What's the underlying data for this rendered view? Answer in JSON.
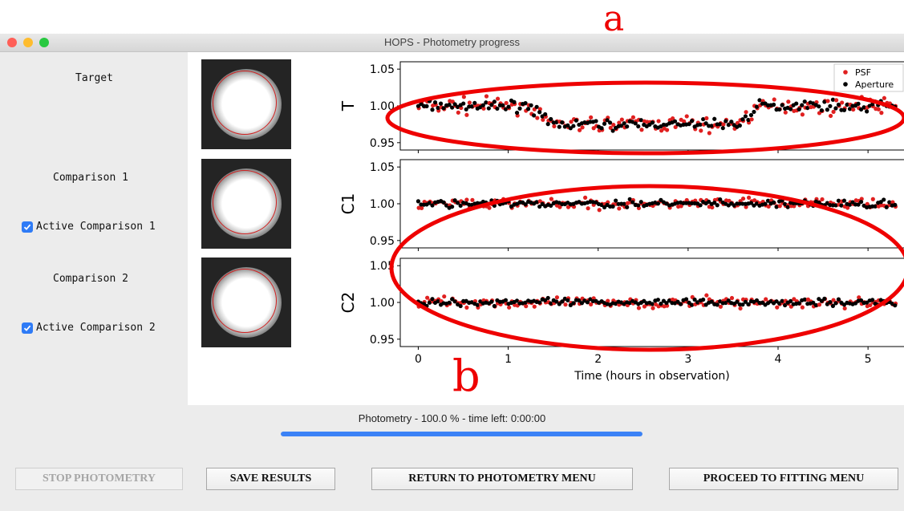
{
  "window": {
    "title": "HOPS - Photometry progress",
    "traffic_lights": [
      "#ff5f57",
      "#febc2e",
      "#28c840"
    ]
  },
  "left_panel": {
    "target_label": "Target",
    "comparison1_label": "Comparison 1",
    "active1_label": "Active Comparison 1",
    "active1_checked": true,
    "comparison2_label": "Comparison 2",
    "active2_label": "Active Comparison 2",
    "active2_checked": true
  },
  "chart_data": {
    "type": "scatter",
    "xlabel": "Time (hours in observation)",
    "xlim": [
      -0.2,
      5.4
    ],
    "xticks": [
      0,
      1,
      2,
      3,
      4,
      5
    ],
    "legend": {
      "placement": "top-right",
      "entries": [
        "PSF",
        "Aperture"
      ]
    },
    "series_colors": {
      "PSF": "#e02020",
      "Aperture": "#000000"
    },
    "panels": [
      {
        "ylabel": "T",
        "ylim": [
          0.94,
          1.06
        ],
        "yticks": [
          0.95,
          1.0,
          1.05
        ],
        "yticklabels": [
          "0.95",
          "1.00",
          "1.05"
        ]
      },
      {
        "ylabel": "C1",
        "ylim": [
          0.94,
          1.06
        ],
        "yticks": [
          0.95,
          1.0,
          1.05
        ],
        "yticklabels": [
          "0.95",
          "1.00",
          "1.05"
        ]
      },
      {
        "ylabel": "C2",
        "ylim": [
          0.94,
          1.06
        ],
        "yticks": [
          0.95,
          1.0,
          1.05
        ],
        "yticklabels": [
          "0.95",
          "1.00",
          "1.05"
        ]
      }
    ]
  },
  "annotations": {
    "label_a": "a",
    "label_b": "b",
    "color": "#ee0000"
  },
  "progress": {
    "text": "Photometry - 100.0 % - time left: 0:00:00",
    "percent": 100,
    "color": "#3b82f6"
  },
  "buttons": {
    "stop": "STOP PHOTOMETRY",
    "save": "SAVE RESULTS",
    "return_menu": "RETURN TO PHOTOMETRY MENU",
    "proceed": "PROCEED TO FITTING MENU"
  }
}
